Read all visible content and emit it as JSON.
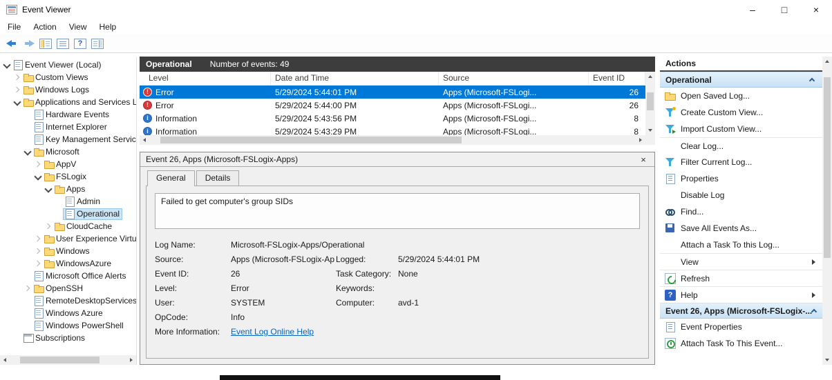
{
  "window": {
    "title": "Event Viewer",
    "controls": {
      "minimize": "–",
      "maximize": "□",
      "close": "×"
    }
  },
  "menu": {
    "items": [
      "File",
      "Action",
      "View",
      "Help"
    ]
  },
  "tree": {
    "items": [
      {
        "label": "Event Viewer (Local)",
        "level": 0,
        "icon": "console",
        "expand": "expanded"
      },
      {
        "label": "Custom Views",
        "level": 1,
        "icon": "folder",
        "expand": "collapsed"
      },
      {
        "label": "Windows Logs",
        "level": 1,
        "icon": "folder",
        "expand": "collapsed"
      },
      {
        "label": "Applications and Services Lo",
        "level": 1,
        "icon": "folder",
        "expand": "expanded"
      },
      {
        "label": "Hardware Events",
        "level": 2,
        "icon": "log"
      },
      {
        "label": "Internet Explorer",
        "level": 2,
        "icon": "log"
      },
      {
        "label": "Key Management Service",
        "level": 2,
        "icon": "log"
      },
      {
        "label": "Microsoft",
        "level": 2,
        "icon": "folder",
        "expand": "expanded"
      },
      {
        "label": "AppV",
        "level": 3,
        "icon": "folder",
        "expand": "collapsed"
      },
      {
        "label": "FSLogix",
        "level": 3,
        "icon": "folder",
        "expand": "expanded"
      },
      {
        "label": "Apps",
        "level": 4,
        "icon": "folder",
        "expand": "expanded"
      },
      {
        "label": "Admin",
        "level": 5,
        "icon": "log"
      },
      {
        "label": "Operational",
        "level": 5,
        "icon": "log",
        "selected": true
      },
      {
        "label": "CloudCache",
        "level": 4,
        "icon": "folder",
        "expand": "collapsed"
      },
      {
        "label": "User Experience Virtu",
        "level": 3,
        "icon": "folder",
        "expand": "collapsed"
      },
      {
        "label": "Windows",
        "level": 3,
        "icon": "folder",
        "expand": "collapsed"
      },
      {
        "label": "WindowsAzure",
        "level": 3,
        "icon": "folder",
        "expand": "collapsed"
      },
      {
        "label": "Microsoft Office Alerts",
        "level": 2,
        "icon": "log"
      },
      {
        "label": "OpenSSH",
        "level": 2,
        "icon": "folder",
        "expand": "collapsed"
      },
      {
        "label": "RemoteDesktopServices",
        "level": 2,
        "icon": "log"
      },
      {
        "label": "Windows Azure",
        "level": 2,
        "icon": "log"
      },
      {
        "label": "Windows PowerShell",
        "level": 2,
        "icon": "log"
      },
      {
        "label": "Subscriptions",
        "level": 1,
        "icon": "subscriptions"
      }
    ]
  },
  "events": {
    "title": "Operational",
    "count_text": "Number of events: 49",
    "columns": [
      "Level",
      "Date and Time",
      "Source",
      "Event ID"
    ],
    "rows": [
      {
        "icon": "error",
        "glyph": "!",
        "level": "Error",
        "datetime": "5/29/2024 5:44:01 PM",
        "source": "Apps (Microsoft-FSLogi...",
        "event_id": "26",
        "selected": true
      },
      {
        "icon": "error",
        "glyph": "!",
        "level": "Error",
        "datetime": "5/29/2024 5:44:00 PM",
        "source": "Apps (Microsoft-FSLogi...",
        "event_id": "26",
        "selected": false
      },
      {
        "icon": "info",
        "glyph": "i",
        "level": "Information",
        "datetime": "5/29/2024 5:43:56 PM",
        "source": "Apps (Microsoft-FSLogi...",
        "event_id": "8",
        "selected": false
      },
      {
        "icon": "info",
        "glyph": "i",
        "level": "Information",
        "datetime": "5/29/2024 5:43:29 PM",
        "source": "Apps (Microsoft-FSLogi...",
        "event_id": "8",
        "selected": false
      }
    ]
  },
  "detail": {
    "title": "Event 26, Apps (Microsoft-FSLogix-Apps)",
    "close_glyph": "×",
    "tabs": [
      {
        "label": "General",
        "active": true
      },
      {
        "label": "Details",
        "active": false
      }
    ],
    "message": "Failed to get computer's group SIDs",
    "rows": [
      {
        "l1": "Log Name:",
        "v1": "Microsoft-FSLogix-Apps/Operational",
        "l2": "",
        "v2": ""
      },
      {
        "l1": "Source:",
        "v1": "Apps (Microsoft-FSLogix-Ap",
        "l2": "Logged:",
        "v2": "5/29/2024 5:44:01 PM"
      },
      {
        "l1": "Event ID:",
        "v1": "26",
        "l2": "Task Category:",
        "v2": "None"
      },
      {
        "l1": "Level:",
        "v1": "Error",
        "l2": "Keywords:",
        "v2": ""
      },
      {
        "l1": "User:",
        "v1": "SYSTEM",
        "l2": "Computer:",
        "v2": "avd-1"
      },
      {
        "l1": "OpCode:",
        "v1": "Info",
        "l2": "",
        "v2": ""
      }
    ],
    "more_info_label": "More Information:",
    "more_info_link": "Event Log Online Help"
  },
  "actions": {
    "title": "Actions",
    "sections": [
      {
        "header": "Operational",
        "items": [
          {
            "label": "Open Saved Log...",
            "icon": "open-folder"
          },
          {
            "label": "Create Custom View...",
            "icon": "funnel-new"
          },
          {
            "label": "Import Custom View...",
            "icon": "funnel-import"
          },
          {
            "label": "Clear Log...",
            "icon": "none",
            "sep": true
          },
          {
            "label": "Filter Current Log...",
            "icon": "funnel"
          },
          {
            "label": "Properties",
            "icon": "properties"
          },
          {
            "label": "Disable Log",
            "icon": "none"
          },
          {
            "label": "Find...",
            "icon": "find"
          },
          {
            "label": "Save All Events As...",
            "icon": "save"
          },
          {
            "label": "Attach a Task To this Log...",
            "icon": "none"
          },
          {
            "label": "View",
            "icon": "none",
            "submenu": true,
            "sep": true
          },
          {
            "label": "Refresh",
            "icon": "refresh",
            "sep": true
          },
          {
            "label": "Help",
            "icon": "help",
            "submenu": true,
            "sep": true
          }
        ]
      },
      {
        "header": "Event 26, Apps (Microsoft-FSLogix-...",
        "items": [
          {
            "label": "Event Properties",
            "icon": "properties"
          },
          {
            "label": "Attach Task To This Event...",
            "icon": "task"
          }
        ]
      }
    ]
  }
}
